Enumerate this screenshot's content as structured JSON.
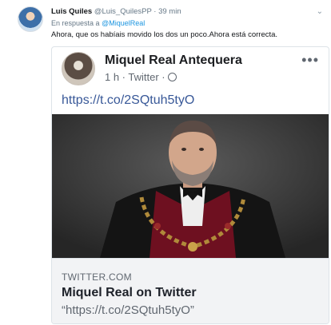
{
  "tweet": {
    "author_name": "Luis Quiles",
    "author_handle": "@Luis_QuilesPP",
    "time": "· 39 min",
    "reply_prefix": "En respuesta a",
    "reply_mention": "@MiquelReal",
    "text": "Ahora, que os habíais movido los dos un poco.Ahora está correcta."
  },
  "embed": {
    "page_name": "Miquel Real Antequera",
    "meta": "1 h · Twitter ·",
    "more_icon": "•••",
    "link": "https://t.co/2SQtuh5tyO",
    "preview": {
      "domain": "TWITTER.COM",
      "title": "Miquel Real on Twitter",
      "description": "“https://t.co/2SQtuh5tyO”"
    }
  },
  "colors": {
    "mention": "#1b95e0",
    "link": "#385898",
    "card_border": "#dde3e8",
    "preview_bg": "#f2f3f5"
  }
}
